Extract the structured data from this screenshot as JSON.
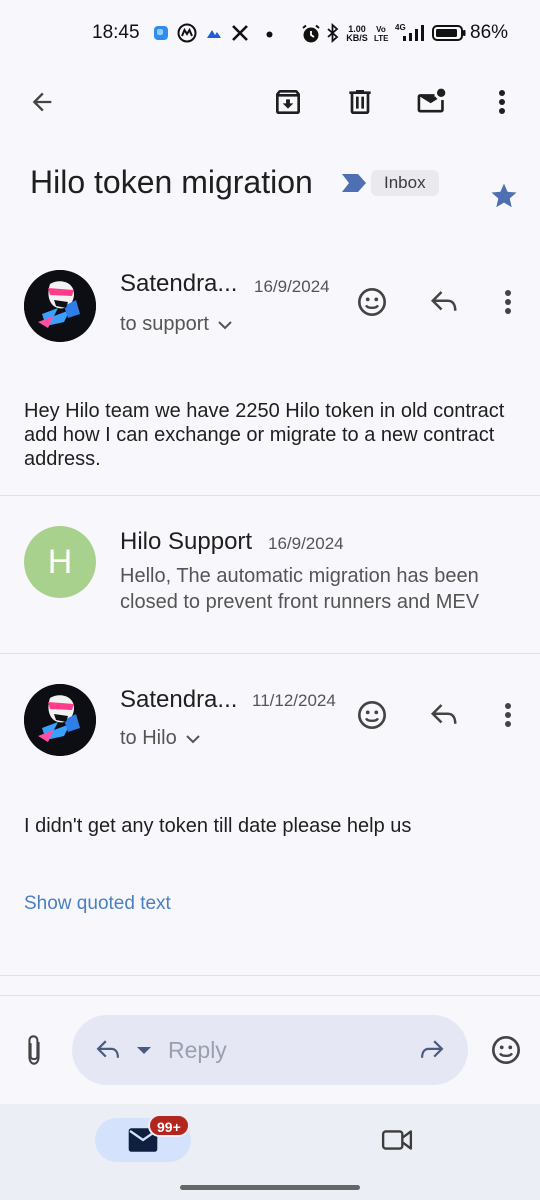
{
  "status_bar": {
    "time": "18:45",
    "net_speed_value": "1.00",
    "net_speed_unit": "KB/S",
    "volte_line1": "Vo",
    "volte_line2": "LTE",
    "network_type": "4G",
    "battery_percent": "86%",
    "notification_icons": [
      "app-icon-blue",
      "coinmarketcap-icon",
      "cloud-icon",
      "x-icon",
      "dot-icon"
    ],
    "system_icons": [
      "alarm-icon",
      "bluetooth-icon",
      "signal-icon",
      "battery-icon"
    ]
  },
  "toolbar": {
    "icons": [
      "back-arrow-icon",
      "archive-icon",
      "delete-icon",
      "mark-unread-icon",
      "more-vert-icon"
    ]
  },
  "thread": {
    "subject": "Hilo token migration",
    "label_chip": "Inbox",
    "starred": true,
    "colors": {
      "star": "#4f6fb3",
      "importance_marker": "#4f6fb3",
      "link": "#4a7fc2",
      "avatar_h": "#a8d18e"
    }
  },
  "messages": [
    {
      "sender": "Satendra...",
      "date": "16/9/2024",
      "recipient": "to support",
      "body": "Hey Hilo team we have 2250 Hilo token in old contract add how I can exchange or migrate to a new contract address."
    },
    {
      "sender": "Hilo Support",
      "date": "16/9/2024",
      "avatar_letter": "H",
      "snippet": "Hello, The automatic migration has been closed to prevent front runners and MEV"
    },
    {
      "sender": "Satendra...",
      "date": "11/12/2024",
      "recipient": "to Hilo",
      "body": "I didn't get any token till date please help us",
      "show_quoted_label": "Show quoted text"
    }
  ],
  "reply_bar": {
    "placeholder": "Reply"
  },
  "bottom_nav": {
    "mail_badge": "99+",
    "colors": {
      "badge": "#b3261e",
      "active_pill": "#d5e2fb"
    }
  }
}
